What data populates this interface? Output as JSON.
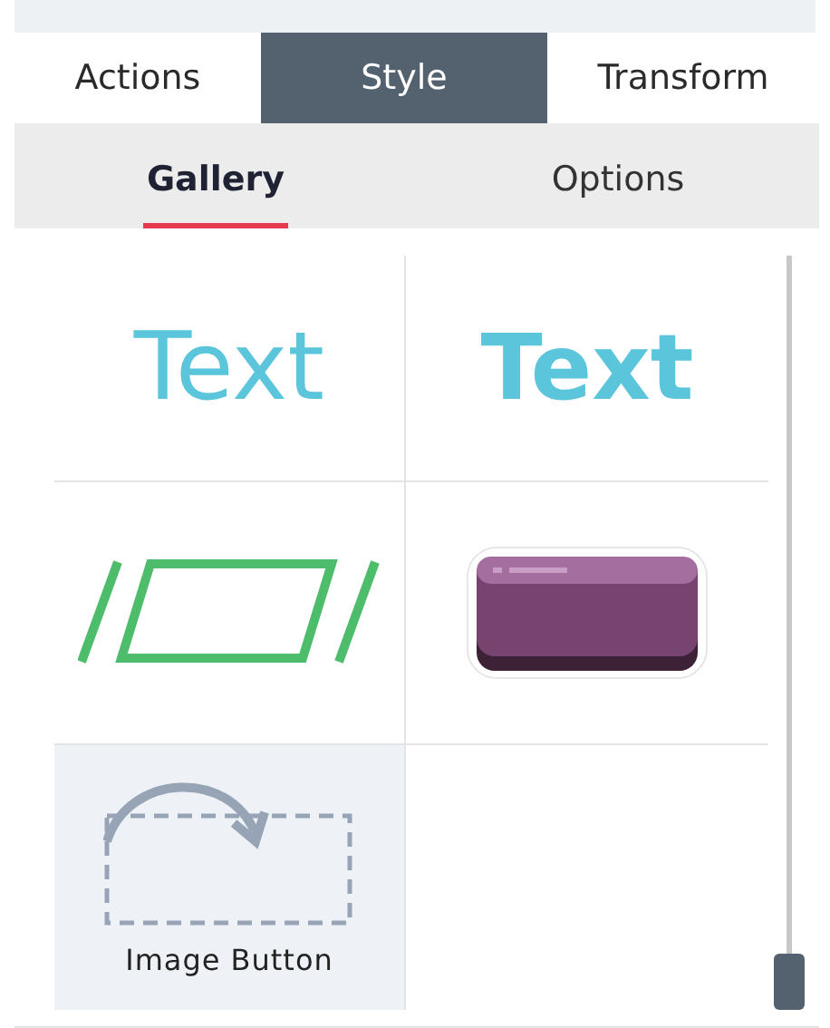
{
  "tabs": [
    {
      "label": "Actions",
      "selected": false
    },
    {
      "label": "Style",
      "selected": true
    },
    {
      "label": "Transform",
      "selected": false
    }
  ],
  "subtabs": [
    {
      "label": "Gallery",
      "selected": true
    },
    {
      "label": "Options",
      "selected": false
    }
  ],
  "gallery": [
    {
      "kind": "text-light",
      "preview": "Text",
      "selected": false
    },
    {
      "kind": "text-bold",
      "preview": "Text",
      "selected": false
    },
    {
      "kind": "parallelogram",
      "selected": false
    },
    {
      "kind": "purple-button",
      "selected": false
    },
    {
      "kind": "image-button",
      "caption": "Image Button",
      "selected": true
    }
  ]
}
